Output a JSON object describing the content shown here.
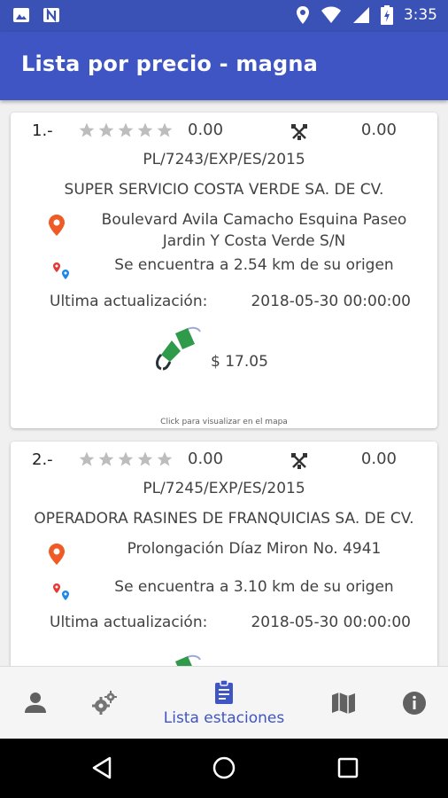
{
  "status_bar": {
    "time": "3:35",
    "icons": [
      "image-icon",
      "n-icon",
      "location-icon",
      "wifi-icon",
      "signal-icon",
      "battery-charging-icon"
    ]
  },
  "app_bar": {
    "title": "Lista por precio - magna"
  },
  "stations": [
    {
      "index": "1.-",
      "rating": "0.00",
      "score": "0.00",
      "permit": "PL/7243/EXP/ES/2015",
      "name": "SUPER SERVICIO COSTA VERDE SA. DE CV.",
      "address_line1": "Boulevard Avila Camacho Esquina Paseo",
      "address_line2": "Jardin Y Costa Verde S/N",
      "distance": "Se encuentra a 2.54 km de su origen",
      "update_label": "Ultima actualización:",
      "update_value": "2018-05-30 00:00:00",
      "price": "$ 17.05",
      "map_hint": "Click para visualizar en el mapa"
    },
    {
      "index": "2.-",
      "rating": "0.00",
      "score": "0.00",
      "permit": "PL/7245/EXP/ES/2015",
      "name": "OPERADORA RASINES DE FRANQUICIAS SA. DE CV.",
      "address_line1": "Prolongación Díaz Miron No. 4941",
      "distance": "Se encuentra a 3.10 km de su origen",
      "update_label": "Ultima actualización:",
      "update_value": "2018-05-30 00:00:00"
    }
  ],
  "bottom_nav": {
    "active_label": "Lista estaciones",
    "items": [
      "person-icon",
      "gears-icon",
      "list-icon",
      "map-icon",
      "info-icon"
    ]
  },
  "colors": {
    "primary": "#3f55c4",
    "status_bar": "#3a52b6",
    "pin": "#f05a24",
    "pump": "#2e9a4a"
  }
}
